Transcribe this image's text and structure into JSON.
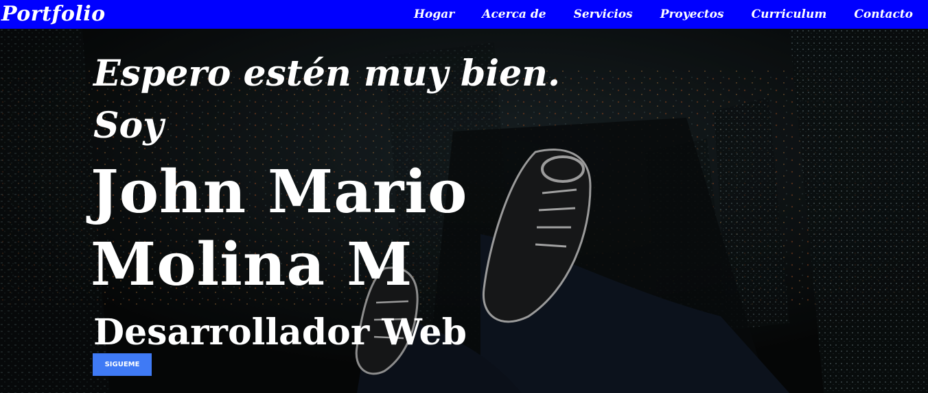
{
  "navbar": {
    "brand": "Portfolio",
    "items": [
      {
        "label": "Hogar"
      },
      {
        "label": "Acerca de"
      },
      {
        "label": "Servicios"
      },
      {
        "label": "Proyectos"
      },
      {
        "label": "Curriculum"
      },
      {
        "label": "Contacto"
      }
    ],
    "background": "#0000ff"
  },
  "hero": {
    "greeting": "Espero estén muy bien.",
    "intro": "Soy",
    "name_line1": "John Mario",
    "name_line2": "Molina M",
    "role": "Desarrollador Web",
    "button_label": "SIGUEME",
    "button_color": "#3f7af5",
    "background_image": "night-city-with-sneakers"
  }
}
